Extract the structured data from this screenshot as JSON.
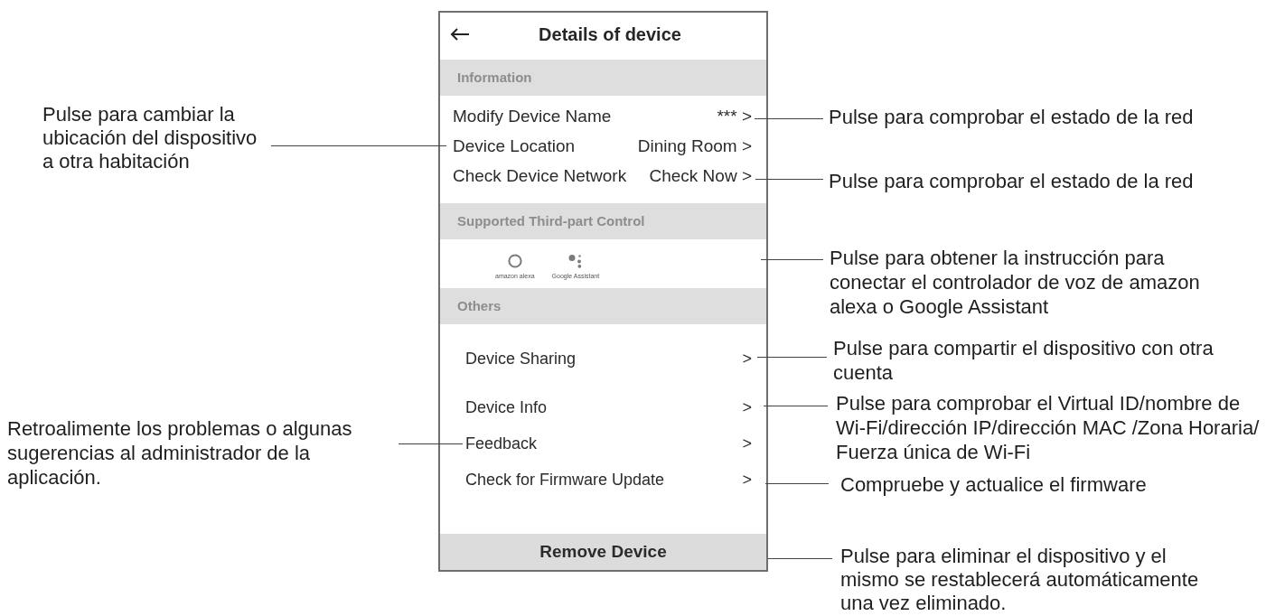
{
  "screen": {
    "title": "Details of device",
    "sections": [
      {
        "kind": "settings",
        "heading": "Information",
        "rows": [
          {
            "label": "Modify Device Name",
            "value": "*** >"
          },
          {
            "label": "Device Location",
            "value": "Dining Room >"
          },
          {
            "label": "Check Device Network",
            "value": "Check Now >"
          }
        ]
      },
      {
        "kind": "integrations",
        "heading": "Supported Third-part Control",
        "items": [
          {
            "kind": "ring",
            "label": "amazon alexa"
          },
          {
            "kind": "dots",
            "label": "Google Assistant"
          }
        ]
      },
      {
        "kind": "links",
        "heading": "Others",
        "rows": [
          {
            "label": "Device Sharing",
            "chevron": ">"
          },
          {
            "label": "Device Info",
            "chevron": ">"
          },
          {
            "label": "Feedback",
            "chevron": ">"
          },
          {
            "label": "Check for Firmware Update",
            "chevron": ">"
          }
        ]
      }
    ],
    "remove_button": "Remove Device"
  },
  "left_notes": [
    {
      "text": "Pulse para cambiar la\nubicación del dispositivo\na otra habitación"
    },
    {
      "text": "Retroalimente los problemas o algunas\nsugerencias al administrador de la\naplicación."
    }
  ],
  "right_notes": [
    {
      "text": "Pulse para comprobar el estado de la red"
    },
    {
      "text": "Pulse para comprobar el estado de la red"
    },
    {
      "text": "Pulse para obtener la instrucción para\nconectar el controlador de voz de amazon\nalexa o Google Assistant"
    },
    {
      "text": "Pulse para compartir el dispositivo con otra\ncuenta"
    },
    {
      "text": "Pulse para comprobar el Virtual ID/nombre de\nWi-Fi/dirección IP/dirección MAC /Zona Horaria/\nFuerza única de Wi-Fi"
    },
    {
      "text": "Compruebe y actualice el firmware"
    },
    {
      "text": "Pulse para eliminar el dispositivo y el\nmismo se restablecerá automáticamente\nuna vez eliminado."
    }
  ]
}
